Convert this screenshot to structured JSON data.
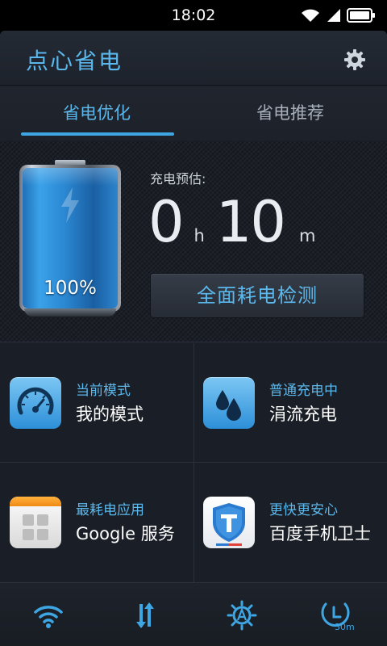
{
  "statusbar": {
    "time": "18:02"
  },
  "app": {
    "title": "点心省电"
  },
  "tabs": [
    {
      "label": "省电优化",
      "active": true
    },
    {
      "label": "省电推荐",
      "active": false
    }
  ],
  "battery": {
    "level_percent": 100,
    "level_text": "100%",
    "estimate_label": "充电预估:",
    "hours": "0",
    "hours_unit": "h",
    "minutes": "10",
    "minutes_unit": "m",
    "detect_button": "全面耗电检测"
  },
  "grid": [
    {
      "caption": "当前模式",
      "value": "我的模式",
      "icon": "gauge-icon"
    },
    {
      "caption": "普通充电中",
      "value": "涓流充电",
      "icon": "water-drops-icon"
    },
    {
      "caption": "最耗电应用",
      "value": "Google 服务",
      "icon": "app-grid-icon"
    },
    {
      "caption": "更快更安心",
      "value": "百度手机卫士",
      "icon": "shield-icon"
    }
  ],
  "bottombar": {
    "items": [
      {
        "icon": "wifi-icon"
      },
      {
        "icon": "data-transfer-icon"
      },
      {
        "icon": "auto-brightness-icon"
      },
      {
        "icon": "screen-timeout-icon",
        "label": "30m"
      }
    ]
  },
  "colors": {
    "accent": "#5bb8ec",
    "background": "#1b2029"
  }
}
